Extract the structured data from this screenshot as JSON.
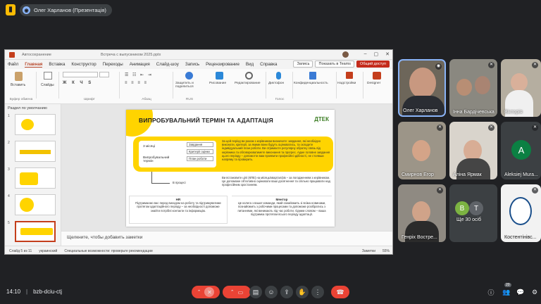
{
  "meeting": {
    "presenter_chip": "Олег Харланов (Презентація)",
    "time": "14:10",
    "meeting_code": "bzb-dciu-ctj",
    "participant_count": "20"
  },
  "ppt": {
    "titlebar_text": "Автосохранение",
    "titlebar_doc": "Встреча с выпускником 2025.pptx",
    "menu": [
      "Файл",
      "Главная",
      "Вставка",
      "Конструктор",
      "Переходы",
      "Анимация",
      "Слайд-шоу",
      "Запись",
      "Рецензирование",
      "Вид",
      "Справка"
    ],
    "menu_active": "Главная",
    "btn_record": "Запись",
    "btn_teams": "Показать в Teams",
    "btn_share": "Общий доступ",
    "ribbon_groups": {
      "clipboard": "Буфер обмена",
      "paste": "Вставить",
      "slides": "Слайды",
      "font": "Шрифт",
      "paragraph": "Абзац",
      "protect": "Защитить и поделиться",
      "drawing": "Рисование",
      "editing": "Редактирование",
      "dictate": "Диктофон",
      "confidentiality": "Конфиденциальность",
      "addins": "Надстройки",
      "designer": "Designer",
      "rus": "RUS",
      "voice": "Голос"
    },
    "section_label": "Раздел по умолчанию",
    "thumb_numbers": [
      "1",
      "2",
      "3",
      "4",
      "5"
    ],
    "notes_placeholder": "Щелкните, чтобы добавить заметки",
    "status": {
      "slide": "Слайд 5 из 11",
      "lang": "украинский",
      "accessibility": "Специальные возможности: проверьте рекомендации",
      "notes": "Заметки",
      "zoom": "55%"
    }
  },
  "slide": {
    "title": "ВИПРОБУВАЛЬНИЙ ТЕРМІН ТА АДАПТАЦІЯ",
    "logo": "ДТЕК",
    "months": "3 місяці",
    "period_label": "Випробувальний термін",
    "tags": [
      "Завдання",
      "Критерії оцінки",
      "План роботи"
    ],
    "in_process": "В процесі",
    "yellow_text": "За цей період ви разом з керівником визначите: завдання, які необхідно виконати, критерії, за якими вони будуть оцінюватись, та складете індивідуальний план роботи. Ви отримаєте регулярну обратну связь від керівника та обговорюватимете виконання та прогрес. Адже головне завдання цього періоду – допомогти вам проявити професійні здібності, не стоявши напряму та провирить.",
    "process_text": "Ви встановите цілі (КПЕ) на місяць/квартал/рік – за погодженням з керівником. Це допоможе об'єктивно оцінювати ваші досягнення та спільно працювати над професійним зростанням.",
    "hr_title": "HR",
    "hr_text": "Підтримаємо вас перед виходом на роботу та підтримуватиме протягом адаптаційного періоду – за необхідності допоможе знайти потрібні контакти та інформацію.",
    "mentor_title": "Ментор",
    "mentor_text": "Це колега з вашої команди, який ознайомить зі всіма новинами, познайомить з робочими процесами та допоможе розібратись з питаннями, які виникають під час роботи. Одним словом – ваша підтримка протягом всього періоду адаптації."
  },
  "participants": [
    {
      "name": "Олег Харланов",
      "type": "video"
    },
    {
      "name": "Інна Бардічевська",
      "type": "video"
    },
    {
      "name": "Вікторія",
      "type": "video"
    },
    {
      "name": "Смирнов Егор",
      "type": "video"
    },
    {
      "name": "Аліна Ярмак",
      "type": "video"
    },
    {
      "name": "Aleksiej Mura...",
      "type": "avatar",
      "letter": "A",
      "color": "#0b8043"
    },
    {
      "name": "Генріх Востре...",
      "type": "video"
    },
    {
      "name": "Ще 30 осіб",
      "type": "group",
      "letters": [
        "B",
        "T"
      ]
    },
    {
      "name": "Костентінівс...",
      "type": "logo"
    }
  ]
}
